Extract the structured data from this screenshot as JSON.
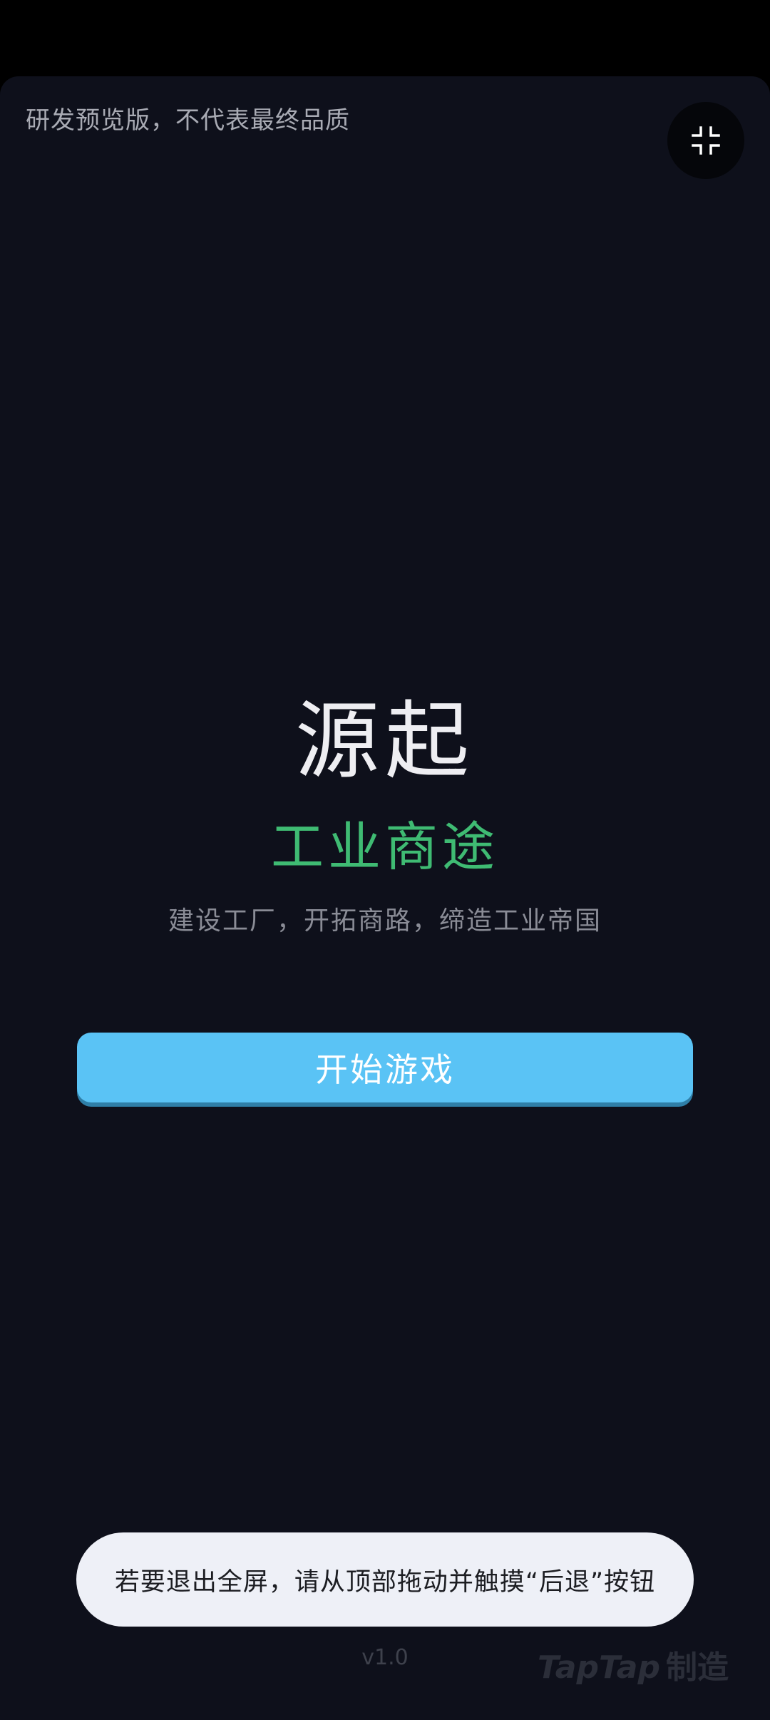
{
  "game": {
    "preview_note": "研发预览版，不代表最终品质",
    "title": "源起",
    "subtitle": "工业商途",
    "tagline": "建设工厂，开拓商路，缔造工业帝国",
    "start_button_label": "开始游戏",
    "version": "v1.0"
  },
  "toast": {
    "message": "若要退出全屏，请从顶部拖动并触摸“后退”按钮"
  },
  "watermark": {
    "brand": "TapTap",
    "suffix": "制造"
  },
  "icons": {
    "exit_fullscreen": "exit-fullscreen-icon"
  },
  "colors": {
    "background": "#0e101b",
    "title": "#eeeef2",
    "subtitle_accent": "#3fbb73",
    "button": "#5ac3f5",
    "toast_bg": "#eef0f7"
  }
}
